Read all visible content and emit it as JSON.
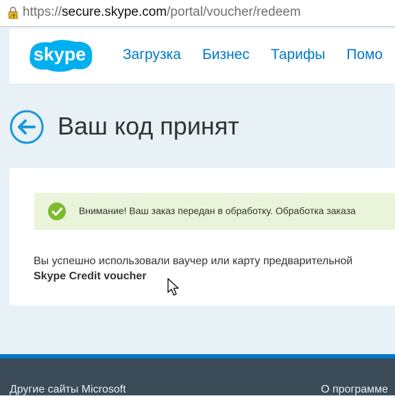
{
  "browser": {
    "url_scheme": "https://",
    "url_host": "secure.skype.com",
    "url_path": "/portal/voucher/redeem",
    "lock_icon": "lock-warning-icon"
  },
  "header": {
    "logo_text": "skype",
    "nav": [
      "Загрузка",
      "Бизнес",
      "Тарифы",
      "Помо"
    ]
  },
  "page": {
    "title": "Ваш код принят",
    "back_icon": "arrow-left-circle-icon"
  },
  "notice": {
    "icon": "check-circle-icon",
    "text": "Внимание! Ваш заказ передан в обработку. Обработка заказа"
  },
  "content": {
    "message": "Вы успешно использовали ваучер или карту предварительной",
    "voucher_name": "Skype Credit voucher"
  },
  "footer": {
    "left_link": "Другие сайты Microsoft",
    "right_link": "О программе"
  },
  "colors": {
    "accent": "#0078ca",
    "skype_blue": "#00aff0",
    "success_green": "#7cbb30",
    "notice_bg": "#eaf4da",
    "footer_bg": "#3b4b58"
  }
}
